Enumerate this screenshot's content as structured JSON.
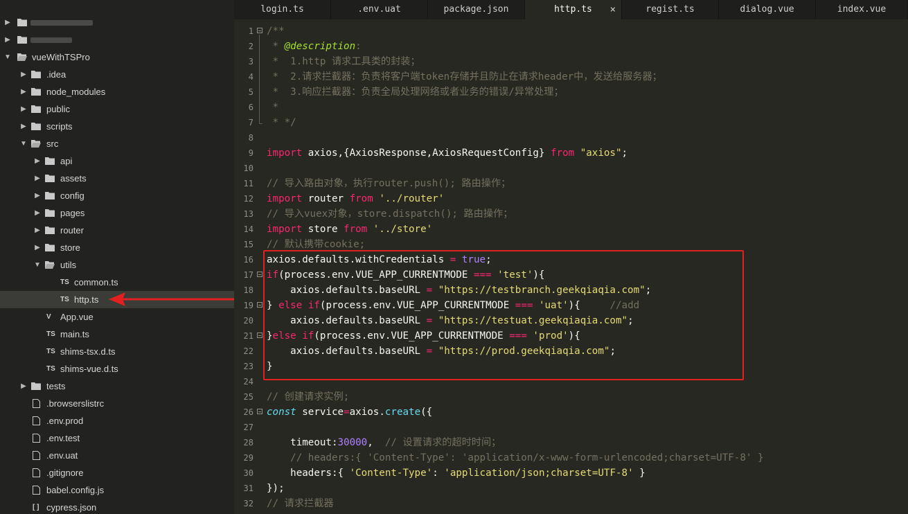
{
  "sidebar": {
    "root_label": "vueWithTSPro",
    "items": [
      {
        "label": ".idea"
      },
      {
        "label": "node_modules"
      },
      {
        "label": "public"
      },
      {
        "label": "scripts"
      },
      {
        "label": "src"
      },
      {
        "label": "api"
      },
      {
        "label": "assets"
      },
      {
        "label": "config"
      },
      {
        "label": "pages"
      },
      {
        "label": "router"
      },
      {
        "label": "store"
      },
      {
        "label": "utils"
      },
      {
        "label": "common.ts",
        "badge": "TS"
      },
      {
        "label": "http.ts",
        "badge": "TS"
      },
      {
        "label": "App.vue",
        "badge": "V"
      },
      {
        "label": "main.ts",
        "badge": "TS"
      },
      {
        "label": "shims-tsx.d.ts",
        "badge": "TS"
      },
      {
        "label": "shims-vue.d.ts",
        "badge": "TS"
      },
      {
        "label": "tests"
      },
      {
        "label": ".browserslistrc"
      },
      {
        "label": ".env.prod"
      },
      {
        "label": ".env.test"
      },
      {
        "label": ".env.uat"
      },
      {
        "label": ".gitignore"
      },
      {
        "label": "babel.config.js"
      },
      {
        "label": "cypress.json",
        "badge": "[ ]"
      }
    ]
  },
  "tabs": [
    {
      "label": "login.ts"
    },
    {
      "label": ".env.uat"
    },
    {
      "label": "package.json"
    },
    {
      "label": "http.ts",
      "active": true
    },
    {
      "label": "regist.ts"
    },
    {
      "label": "dialog.vue"
    },
    {
      "label": "index.vue"
    }
  ],
  "tab_close_glyph": "×",
  "line_numbers": [
    "1",
    "2",
    "3",
    "4",
    "5",
    "6",
    "7",
    "8",
    "9",
    "10",
    "11",
    "12",
    "13",
    "14",
    "15",
    "16",
    "17",
    "18",
    "19",
    "20",
    "21",
    "22",
    "23",
    "24",
    "25",
    "26",
    "27",
    "28",
    "29",
    "30",
    "31",
    "32"
  ],
  "code": {
    "l1": "/**",
    "l2_star": " * ",
    "l2_tag": "@description",
    "l2_colon": ":",
    "l3": " *  1.http 请求工具类的封装；",
    "l4": " *  2.请求拦截器：负责将客户端token存储并且防止在请求header中，发送给服务器；",
    "l5": " *  3.响应拦截器：负责全局处理网络或者业务的错误/异常处理；",
    "l6": " *",
    "l7": " * */",
    "l9_import": "import",
    "l9_mid": " axios,{AxiosResponse,AxiosRequestConfig} ",
    "l9_from": "from",
    "l9_str": "\"axios\"",
    "l9_end": ";",
    "l11": "// 导入路由对象，执行router.push(); 路由操作；",
    "l12_import": "import",
    "l12_mid": " router ",
    "l12_from": "from",
    "l12_str": "'../router'",
    "l13": "// 导入vuex对象，store.dispatch(); 路由操作；",
    "l14_import": "import",
    "l14_mid": " store ",
    "l14_from": "from",
    "l14_str": "'../store'",
    "l15": "// 默认携带cookie;",
    "l16_a": "axios.defaults.withCredentials ",
    "l16_eq": "=",
    "l16_sp": " ",
    "l16_true": "true",
    "l16_end": ";",
    "l17_if": "if",
    "l17_a": "(process.env.VUE_APP_CURRENTMODE ",
    "l17_op": "===",
    "l17_sp": " ",
    "l17_str": "'test'",
    "l17_end": "){",
    "l18_a": "    axios.defaults.baseURL ",
    "l18_eq": "=",
    "l18_sp": " ",
    "l18_str": "\"https://testbranch.geekqiaqia.com\"",
    "l18_end": ";",
    "l19_a": "} ",
    "l19_else": "else",
    "l19_sp": " ",
    "l19_if": "if",
    "l19_b": "(process.env.VUE_APP_CURRENTMODE ",
    "l19_op": "===",
    "l19_sp2": " ",
    "l19_str": "'uat'",
    "l19_end": "){     ",
    "l19_cmt": "//add",
    "l20_a": "    axios.defaults.baseURL ",
    "l20_eq": "=",
    "l20_sp": " ",
    "l20_str": "\"https://testuat.geekqiaqia.com\"",
    "l20_end": ";",
    "l21_a": "}",
    "l21_else": "else",
    "l21_sp": " ",
    "l21_if": "if",
    "l21_b": "(process.env.VUE_APP_CURRENTMODE ",
    "l21_op": "===",
    "l21_sp2": " ",
    "l21_str": "'prod'",
    "l21_end": "){",
    "l22_a": "    axios.defaults.baseURL ",
    "l22_eq": "=",
    "l22_sp": " ",
    "l22_str": "\"https://prod.geekqiaqia.com\"",
    "l22_end": ";",
    "l23": "}",
    "l25": "// 创建请求实例;",
    "l26_const": "const",
    "l26_a": " service",
    "l26_eq": "=",
    "l26_b": "axios.",
    "l26_fn": "create",
    "l26_end": "({",
    "l28_a": "    timeout:",
    "l28_num": "30000",
    "l28_b": ",  ",
    "l28_cmt": "// 设置请求的超时时间；",
    "l29": "    // headers:{ 'Content-Type': 'application/x-www-form-urlencoded;charset=UTF-8' }",
    "l30_a": "    headers:{ ",
    "l30_k": "'Content-Type'",
    "l30_b": ": ",
    "l30_v": "'application/json;charset=UTF-8'",
    "l30_end": " }",
    "l31": "});",
    "l32": "// 请求拦截器"
  },
  "colors": {
    "highlight_box": "#e0211f",
    "arrow": "#e0211f",
    "keyword": "#f92672",
    "string": "#e6db74",
    "comment": "#75715e",
    "number": "#ae81ff",
    "function": "#66d9ef"
  }
}
